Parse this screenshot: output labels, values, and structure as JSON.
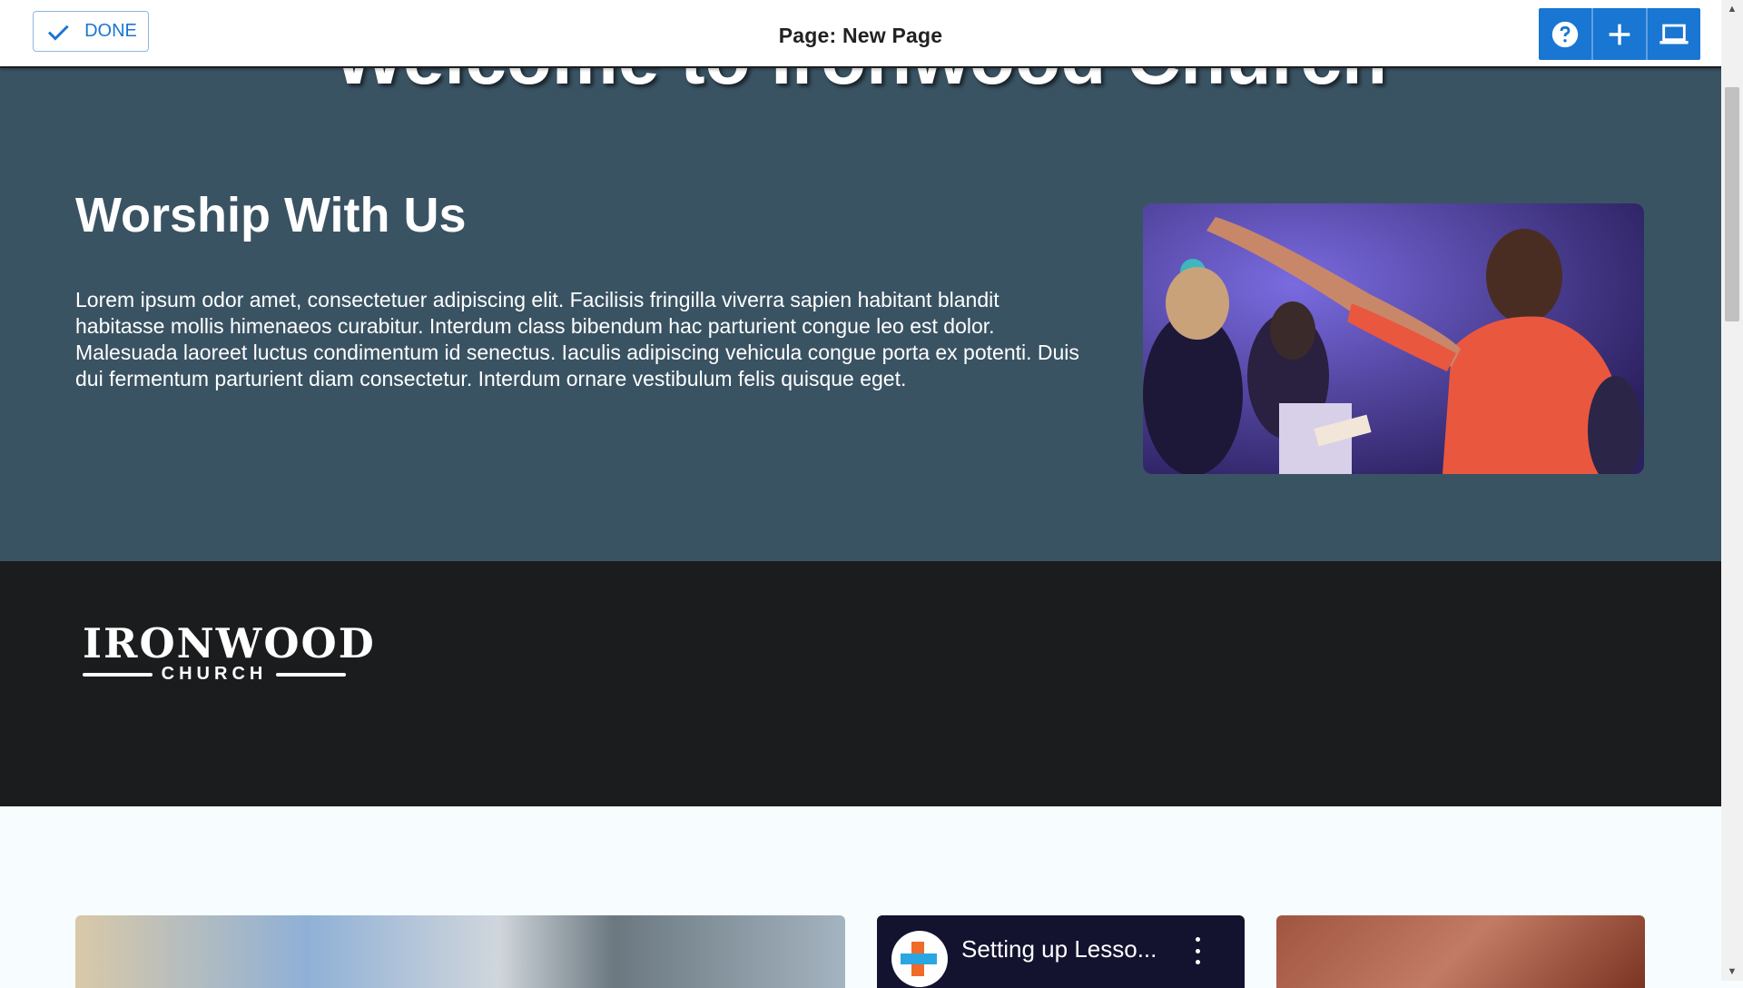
{
  "toolbar": {
    "done_label": "DONE",
    "page_title": "Page: New Page",
    "help_icon": "help-circle-icon",
    "add_icon": "plus-icon",
    "preview_icon": "laptop-icon"
  },
  "hero": {
    "heading": "Welcome to Ironwood Church",
    "section_title": "Worship With Us",
    "section_body": "Lorem ipsum odor amet, consectetuer adipiscing elit. Facilisis fringilla viverra sapien habitant blandit habitasse mollis himenaeos curabitur. Interdum class bibendum hac parturient congue leo est dolor. Malesuada laoreet luctus condimentum id senectus. Iaculis adipiscing vehicula congue porta ex potenti. Duis dui fermentum parturient diam consectetur. Interdum ornare vestibulum felis quisque eget."
  },
  "footer": {
    "logo_main": "IRONWOOD",
    "logo_sub": "CHURCH"
  },
  "cards": {
    "video_title": "Setting up Lesso..."
  },
  "colors": {
    "accent": "#1976d2",
    "hero_bg": "#3a5363",
    "footer_bg": "#1b1c1e",
    "page_bg": "#f7fdfe"
  }
}
